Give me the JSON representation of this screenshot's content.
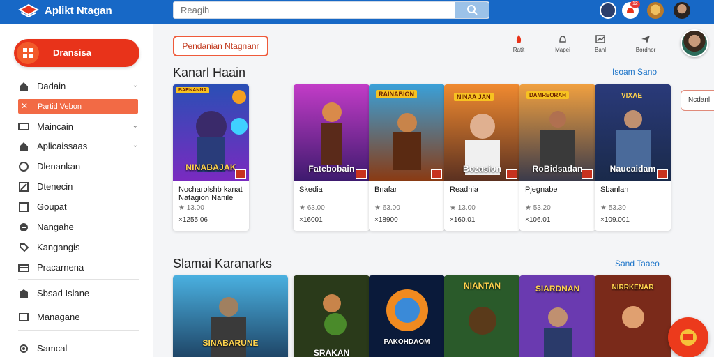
{
  "app": {
    "title": "Aplikt Ntagan"
  },
  "search": {
    "placeholder": "Reagih"
  },
  "topbar": {
    "notification_count": "12"
  },
  "sidebar": {
    "primary_button": "Dransisa",
    "items": [
      {
        "label": "Dadain",
        "icon": "home-icon",
        "has_chevron": true
      },
      {
        "label": "Partid Vebon",
        "icon": "x-icon",
        "active": true
      },
      {
        "label": "Maincain",
        "icon": "monitor-icon",
        "has_chevron": true
      },
      {
        "label": "Aplicaissaas",
        "icon": "home-icon",
        "has_chevron": true
      },
      {
        "label": "Dlenankan",
        "icon": "clock-icon"
      },
      {
        "label": "Dtenecin",
        "icon": "edit-icon"
      },
      {
        "label": "Goupat",
        "icon": "grid-icon"
      },
      {
        "label": "Nangahe",
        "icon": "compass-icon"
      },
      {
        "label": "Kangangis",
        "icon": "tag-icon"
      },
      {
        "label": "Pracarnena",
        "icon": "card-icon"
      },
      {
        "label": "Sbsad Islane",
        "icon": "building-icon"
      },
      {
        "label": "Managane",
        "icon": "image-icon"
      },
      {
        "label": "Samcal",
        "icon": "settings-icon"
      }
    ]
  },
  "toolbar": {
    "filter_label": "Pendanian Ntagnanr",
    "actions": [
      {
        "label": "Ratit",
        "icon": "fire-icon"
      },
      {
        "label": "Mapei",
        "icon": "bell-icon"
      },
      {
        "label": "Banl",
        "icon": "chart-icon"
      },
      {
        "label": "Bordnor",
        "icon": "paper-plane-icon"
      }
    ]
  },
  "section1": {
    "title": "Kanarl Haain",
    "see_all": "Isoam Sano",
    "cards": [
      {
        "art_title": "NINABAJAK",
        "tag": "BARNANNA",
        "name": "Nocharolshb kanat Natagion Nanile",
        "rating": "★ 13.00",
        "downloads": "×1255.06"
      },
      {
        "art_title": "Fatebobain",
        "tag": "",
        "name": "Skedia",
        "rating": "★ 63.00",
        "downloads": "×16001"
      },
      {
        "art_title": "",
        "tag": "RAINABION",
        "name": "Bnafar",
        "rating": "★ 63.00",
        "downloads": "×18900"
      },
      {
        "art_title": "Bozasion",
        "tag": "NINAA JAN",
        "name": "Readhia",
        "rating": "★ 13.00",
        "downloads": "×160.01"
      },
      {
        "art_title": "RoBidsadan",
        "tag": "DAMREORAH",
        "name": "Pjegnabe",
        "rating": "★ 53.20",
        "downloads": "×106.01"
      },
      {
        "art_title": "Naueaidam",
        "tag": "VIXAE",
        "name": "Sbanlan",
        "rating": "★ 53.30",
        "downloads": "×109.001"
      }
    ]
  },
  "section2": {
    "title": "Slamai Karanarks",
    "see_all": "Sand Taaeo",
    "cards": [
      {
        "art_title": "SINABARUNE"
      },
      {
        "art_title": "SRAKAN"
      },
      {
        "art_title": "PAKOHDAOM"
      },
      {
        "art_title": "NIANTAN"
      },
      {
        "art_title": "SIARDNAN"
      },
      {
        "art_title": "NIRRKENAR"
      }
    ]
  },
  "right_panel": {
    "pill_label": "Ncdanl"
  },
  "colors": {
    "topbar": "#1768c6",
    "accent": "#e8331a",
    "link": "#1a73c8"
  }
}
